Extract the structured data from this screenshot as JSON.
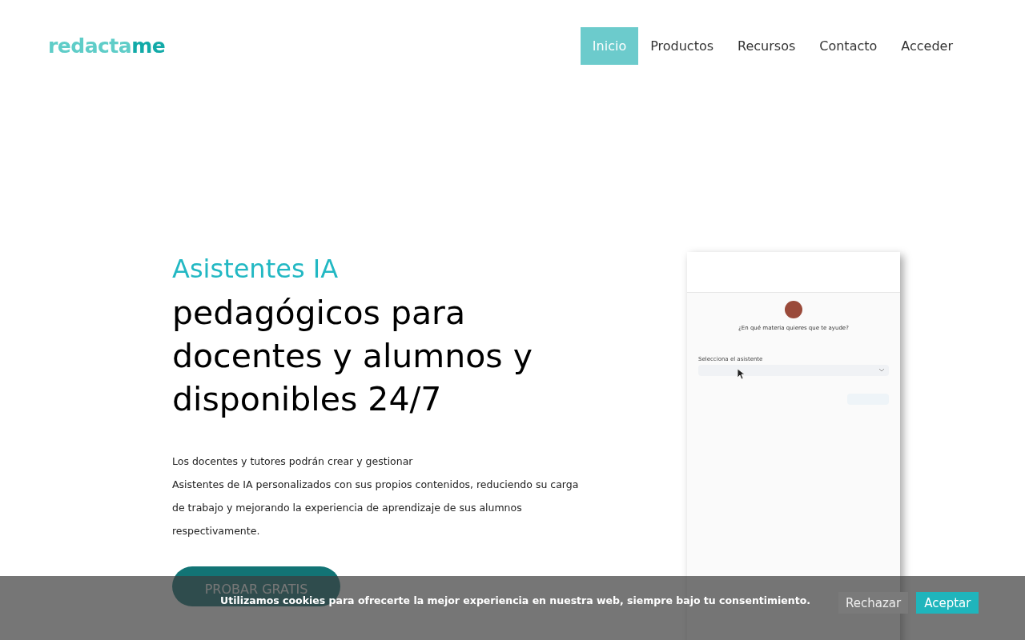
{
  "logo": {
    "main": "redacta",
    "accent": "me"
  },
  "nav": [
    {
      "label": "Inicio",
      "selected": true
    },
    {
      "label": "Productos",
      "selected": false
    },
    {
      "label": "Recursos",
      "selected": false
    },
    {
      "label": "Contacto",
      "selected": false
    },
    {
      "label": "Acceder",
      "selected": false
    }
  ],
  "hero": {
    "kicker": "Asistentes IA",
    "title": "pedagógicos para docentes y alumnos y disponibles 24/7",
    "paragraph": [
      "Los docentes y tutores podrán crear y gestionar",
      "Asistentes de IA personalizados con sus propios contenidos, reduciendo su carga de trabajo y mejorando la experiencia de aprendizaje de sus alumnos respectivamente."
    ],
    "cta": "PROBAR GRATIS"
  },
  "preview": {
    "question": "¿En qué materia quieres que te ayude?",
    "select_label": "Selecciona el asistente"
  },
  "cookie_bar": {
    "message": "Utilizamos cookies para ofrecerte la mejor experiencia en nuestra web, siempre bajo tu consentimiento.",
    "reject": "Rechazar",
    "accept": "Aceptar"
  }
}
